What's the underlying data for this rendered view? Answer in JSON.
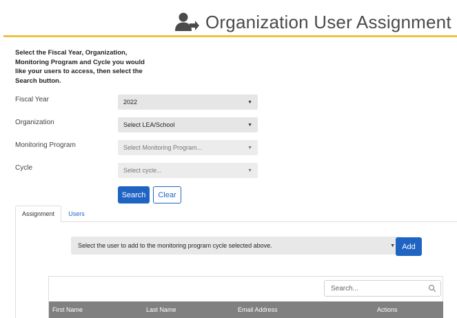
{
  "header": {
    "title": "Organization User Assignment",
    "icon": "users-arrow-icon"
  },
  "instructions": "Select the Fiscal Year, Organization, Monitoring Program and Cycle you would like your users to access, then select the Search button.",
  "form": {
    "fiscal_year": {
      "label": "Fiscal Year",
      "value": "2022"
    },
    "organization": {
      "label": "Organization",
      "value": "Select LEA/School"
    },
    "monitoring_program": {
      "label": "Monitoring Program",
      "value": "Select Monitoring Program..."
    },
    "cycle": {
      "label": "Cycle",
      "value": "Select cycle..."
    },
    "search_label": "Search",
    "clear_label": "Clear"
  },
  "tabs": [
    {
      "label": "Assignment",
      "active": true
    },
    {
      "label": "Users",
      "active": false
    }
  ],
  "assignment": {
    "user_select_placeholder": "Select the user to add to the monitoring program cycle selected above.",
    "add_label": "Add"
  },
  "table": {
    "search_placeholder": "Search...",
    "columns": [
      "First Name",
      "Last Name",
      "Email Address",
      "Actions"
    ]
  },
  "colors": {
    "accent": "#1f64c3",
    "header_rule": "#f0c040",
    "table_header": "#808080"
  }
}
